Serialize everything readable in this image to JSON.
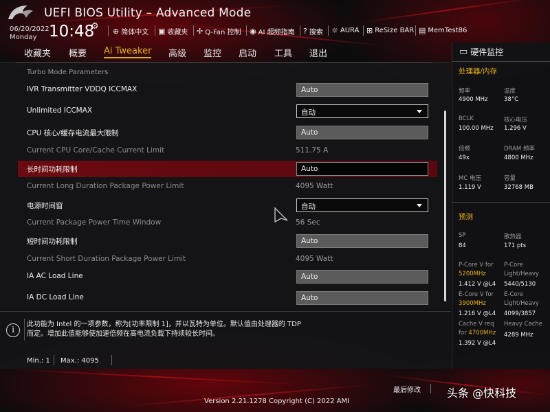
{
  "header": {
    "title": "UEFI BIOS Utility – Advanced Mode",
    "date": "06/20/2022",
    "day": "Monday",
    "time": "10:48",
    "quick": [
      {
        "icon": "globe-icon",
        "label": "简体中文"
      },
      {
        "icon": "bookmark-icon",
        "label": "收藏夹"
      },
      {
        "icon": "fan-icon",
        "label": "Q-Fan 控制"
      },
      {
        "icon": "ai-icon",
        "label": "AI 超频指南"
      },
      {
        "icon": "search-help-icon",
        "label": "搜索"
      },
      {
        "icon": "aura-icon",
        "label": "AURA"
      },
      {
        "icon": "resize-bar-icon",
        "label": "ReSize BAR"
      },
      {
        "icon": "memtest-icon",
        "label": "MemTest86"
      }
    ]
  },
  "tabs": [
    "收藏夹",
    "概要",
    "Ai Tweaker",
    "高级",
    "监控",
    "启动",
    "工具",
    "退出"
  ],
  "active_tab": "Ai Tweaker",
  "main": {
    "section_title": "Turbo Mode Parameters",
    "rows": [
      {
        "label": "IVR Transmitter VDDQ ICCMAX",
        "kind": "field",
        "value": "Auto"
      },
      {
        "label": "Unlimited ICCMAX",
        "kind": "select",
        "value": "自动"
      },
      {
        "label": "CPU 核心/缓存电流最大限制",
        "kind": "field",
        "value": "Auto"
      },
      {
        "label": "Current CPU Core/Cache Current Limit",
        "kind": "info",
        "value": "511.75 A"
      },
      {
        "label": "长时间功耗限制",
        "kind": "field-dark",
        "value": "Auto"
      },
      {
        "label": "Current Long Duration Package Power Limit",
        "kind": "info",
        "value": "4095 Watt"
      },
      {
        "label": "电源时间窗",
        "kind": "select",
        "value": "自动"
      },
      {
        "label": "Current Package Power Time Window",
        "kind": "info",
        "value": "56 Sec"
      },
      {
        "label": "短时间功耗限制",
        "kind": "field",
        "value": "Auto"
      },
      {
        "label": "Current Short Duration Package Power Limit",
        "kind": "info",
        "value": "4095 Watt"
      },
      {
        "label": "IA AC Load Line",
        "kind": "field",
        "value": "Auto"
      },
      {
        "label": "IA DC Load Line",
        "kind": "field",
        "value": "Auto"
      }
    ]
  },
  "help": {
    "text_line1": "此功能为 Intel 的一项参数，称为[功率限制 1]，并以瓦特为单位。默认值由处理器的 TDP",
    "text_line2": "而定。增加此值能够使加速倍频在高电流负载下持续较长时间。",
    "min": "Min.: 1",
    "max": "Max.: 4095"
  },
  "hw_monitor": {
    "title": "硬件监控",
    "cpu_mem_title": "处理器/内存",
    "freq_label": "频率",
    "freq_val": "4900 MHz",
    "temp_label": "温度",
    "temp_val": "38°C",
    "bclk_label": "BCLK",
    "bclk_val": "100.00 MHz",
    "vcore_label": "核心电压",
    "vcore_val": "1.296 V",
    "ratio_label": "倍频",
    "ratio_val": "49x",
    "dram_label": "DRAM 频率",
    "dram_val": "4800 MHz",
    "mcv_label": "MC 电压",
    "mcv_val": "1.119 V",
    "cap_label": "容量",
    "cap_val": "32768 MB",
    "predict_title": "预测",
    "sp_label": "SP",
    "sp_val": "84",
    "cooler_label": "散热器",
    "cooler_val": "171 pts",
    "pcore_label": "P-Core V for",
    "pcore_freq": "5200MHz",
    "pcore_val": "1.412 V @L4",
    "pcore_lh_label1": "P-Core",
    "pcore_lh_label2": "Light/Heavy",
    "pcore_lh_val": "5440/5130",
    "ecore_label": "E-Core V for",
    "ecore_freq": "3900MHz",
    "ecore_val": "1.216 V @L4",
    "ecore_lh_label1": "E-Core",
    "ecore_lh_label2": "Light/Heavy",
    "ecore_lh_val": "4099/3857",
    "cache_label1": "Cache V req",
    "cache_label2": "for",
    "cache_freq": "4700MHz",
    "cache_val": "1.392 V @L4",
    "hcache_label1": "Heavy Cache",
    "hcache_val": "4289 MHz"
  },
  "footer": {
    "version": "Version 2.21.1278 Copyright (C) 2022 AMI",
    "last_modified": "最后修改",
    "watermark": "头条 @快科技"
  },
  "colors": {
    "accent": "#e5b01d",
    "highlight": "#6b0a10",
    "brand_red": "#c4101c"
  }
}
